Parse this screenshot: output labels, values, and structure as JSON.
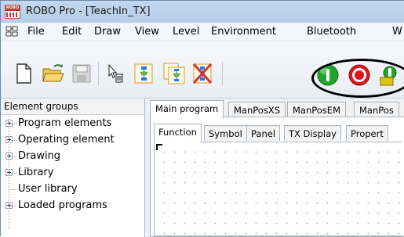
{
  "window": {
    "title": "ROBO Pro - [TeachIn_TX]",
    "icon_text": "ROBO"
  },
  "menu": {
    "items": [
      "File",
      "Edit",
      "Draw",
      "View",
      "Level",
      "Environment",
      "Bluetooth",
      "W"
    ]
  },
  "toolbar": {
    "buttons": [
      "new-file-icon",
      "open-folder-icon",
      "save-disk-icon",
      "cursor-delete-icon",
      "new-subprogram-icon",
      "copy-subprogram-icon",
      "delete-subprogram-icon",
      "start-button-icon",
      "stop-button-icon",
      "download-icon"
    ],
    "colors": {
      "start": "#1fa82a",
      "stop": "#e1141b",
      "download": "#d6b600"
    }
  },
  "left_panel": {
    "header": "Element groups",
    "items": [
      {
        "label": "Program elements",
        "expandable": true
      },
      {
        "label": "Operating element",
        "expandable": true
      },
      {
        "label": "Drawing",
        "expandable": true
      },
      {
        "label": "Library",
        "expandable": true
      },
      {
        "label": "User library",
        "expandable": false
      },
      {
        "label": "Loaded programs",
        "expandable": true
      }
    ]
  },
  "main": {
    "tabs": [
      "Main program",
      "ManPosXS",
      "ManPosEM",
      "ManPos"
    ],
    "active_tab": "Main program",
    "subtabs": [
      "Function",
      "Symbol",
      "Panel",
      "TX Display",
      "Propert"
    ],
    "active_subtab": "Function"
  }
}
